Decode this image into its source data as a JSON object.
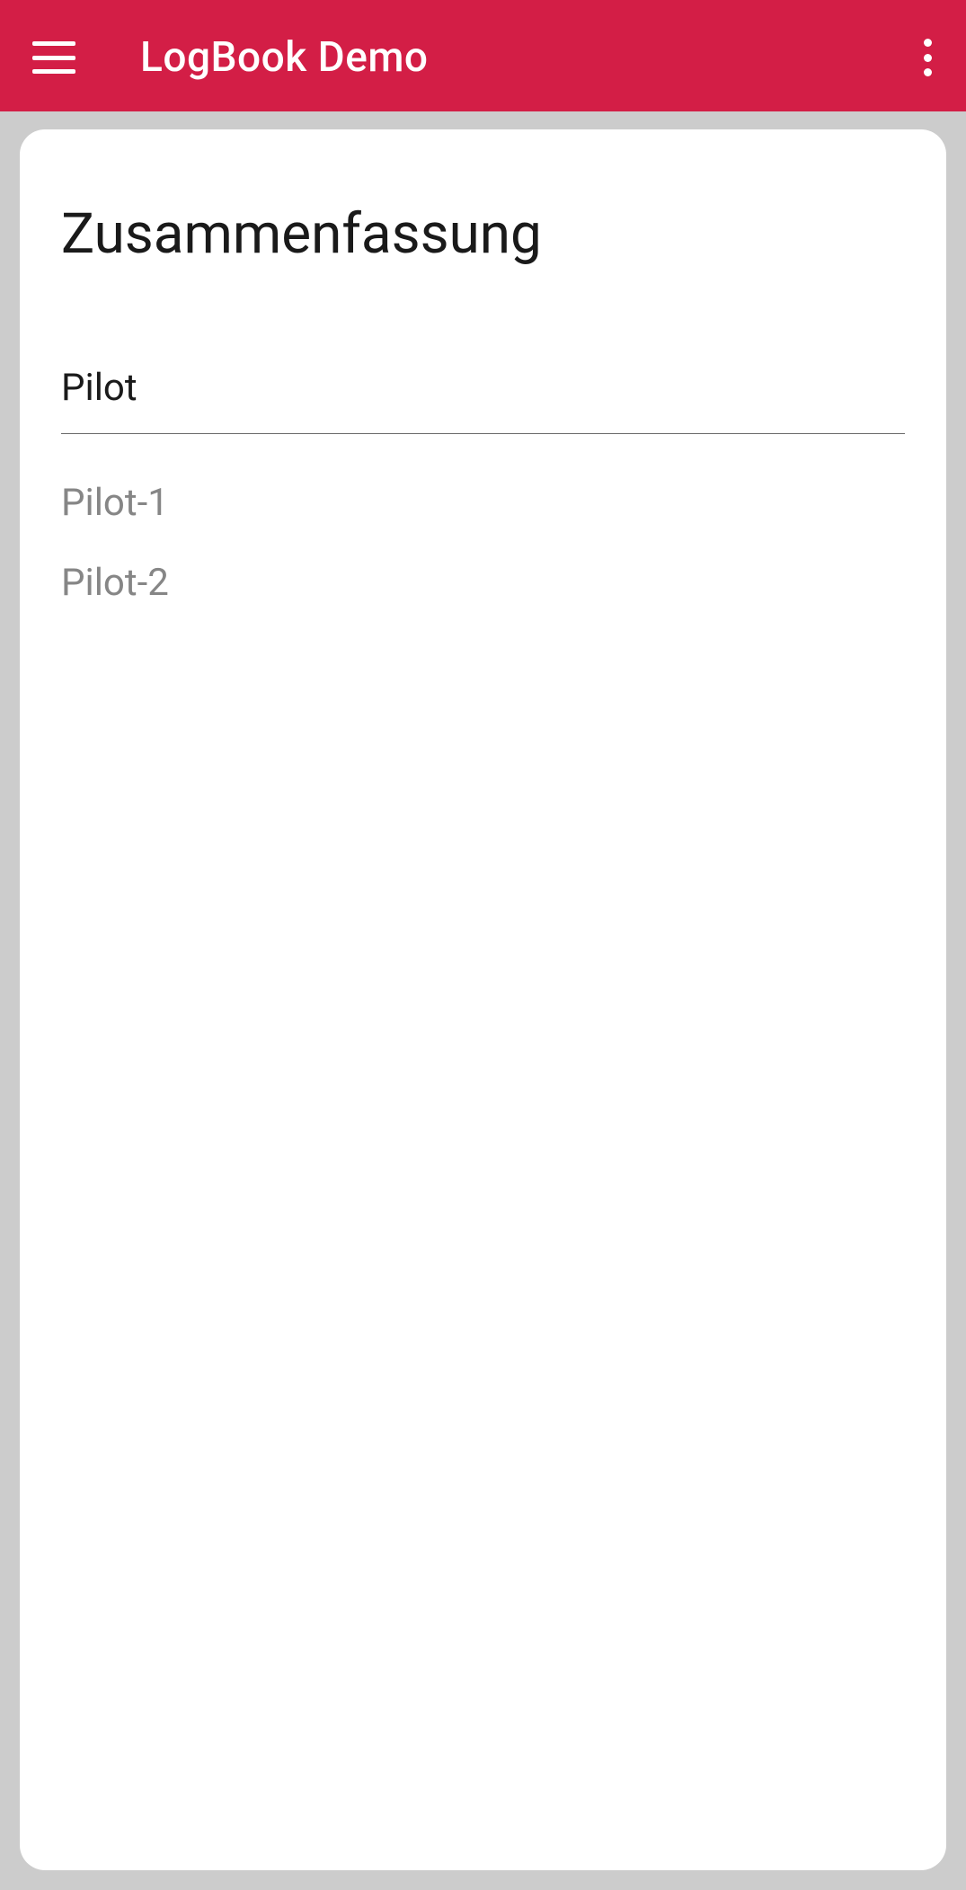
{
  "header": {
    "title": "LogBook Demo"
  },
  "card": {
    "title": "Zusammenfassung",
    "select": {
      "label": "Pilot",
      "options": [
        "Pilot-1",
        "Pilot-2"
      ]
    }
  }
}
